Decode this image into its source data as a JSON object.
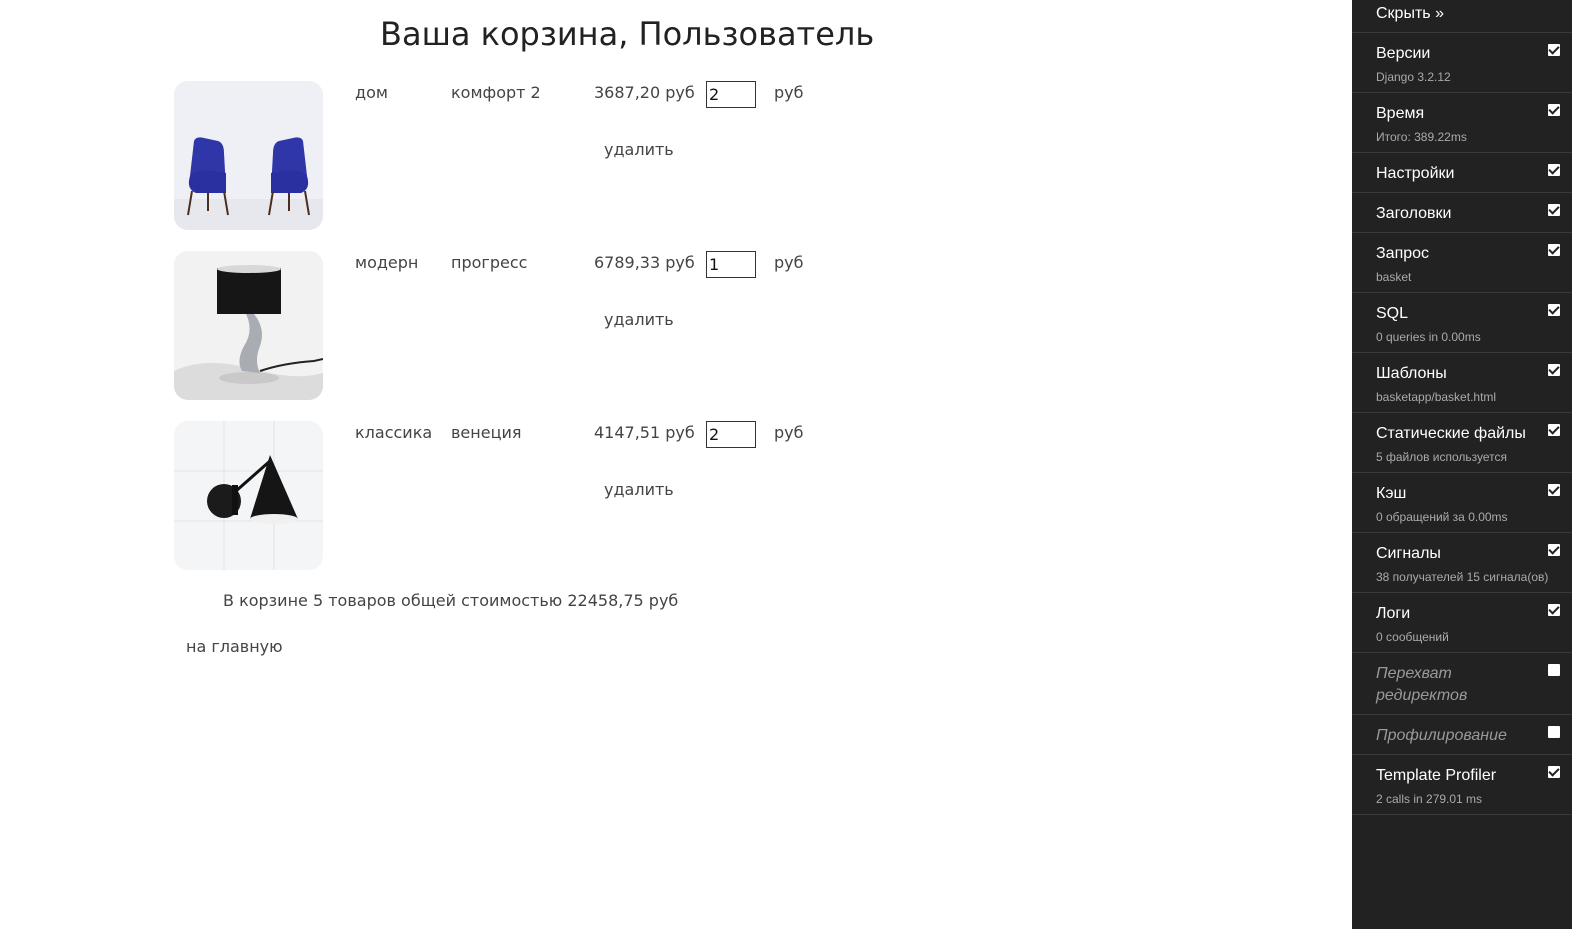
{
  "cart": {
    "title": "Ваша корзина, Пользователь",
    "items": [
      {
        "style": "дом",
        "name": "комфорт 2",
        "price": "3687,20 руб",
        "qty": "2",
        "currency": "руб",
        "delete_label": "удалить",
        "image": "blue-chairs-image"
      },
      {
        "style": "модерн",
        "name": "прогресс",
        "price": "6789,33 руб",
        "qty": "1",
        "currency": "руб",
        "delete_label": "удалить",
        "image": "table-lamp-image"
      },
      {
        "style": "классика",
        "name": "венеция",
        "price": "4147,51 руб",
        "qty": "2",
        "currency": "руб",
        "delete_label": "удалить",
        "image": "wall-lamp-image"
      }
    ],
    "summary": "В корзине 5 товаров общей стоимостью 22458,75 руб",
    "home_link": "на главную"
  },
  "toolbar": {
    "hide_label": "Скрыть »",
    "panels": [
      {
        "name": "Версии",
        "subtitle": "Django 3.2.12",
        "enabled": true
      },
      {
        "name": "Время",
        "subtitle": "Итого: 389.22ms",
        "enabled": true
      },
      {
        "name": "Настройки",
        "subtitle": "",
        "enabled": true
      },
      {
        "name": "Заголовки",
        "subtitle": "",
        "enabled": true
      },
      {
        "name": "Запрос",
        "subtitle": "basket",
        "enabled": true
      },
      {
        "name": "SQL",
        "subtitle": "0 queries in 0.00ms",
        "enabled": true
      },
      {
        "name": "Шаблоны",
        "subtitle": "basketapp/basket.html",
        "enabled": true
      },
      {
        "name": "Статические файлы",
        "subtitle": "5 файлов используется",
        "enabled": true
      },
      {
        "name": "Кэш",
        "subtitle": "0 обращений за 0.00ms",
        "enabled": true
      },
      {
        "name": "Сигналы",
        "subtitle": "38 получателей 15 сигнала(ов)",
        "enabled": true
      },
      {
        "name": "Логи",
        "subtitle": "0 сообщений",
        "enabled": true
      },
      {
        "name": "Перехват редиректов",
        "subtitle": "",
        "enabled": false
      },
      {
        "name": "Профилирование",
        "subtitle": "",
        "enabled": false
      },
      {
        "name": "Template Profiler",
        "subtitle": "2 calls in 279.01 ms",
        "enabled": true
      }
    ]
  }
}
